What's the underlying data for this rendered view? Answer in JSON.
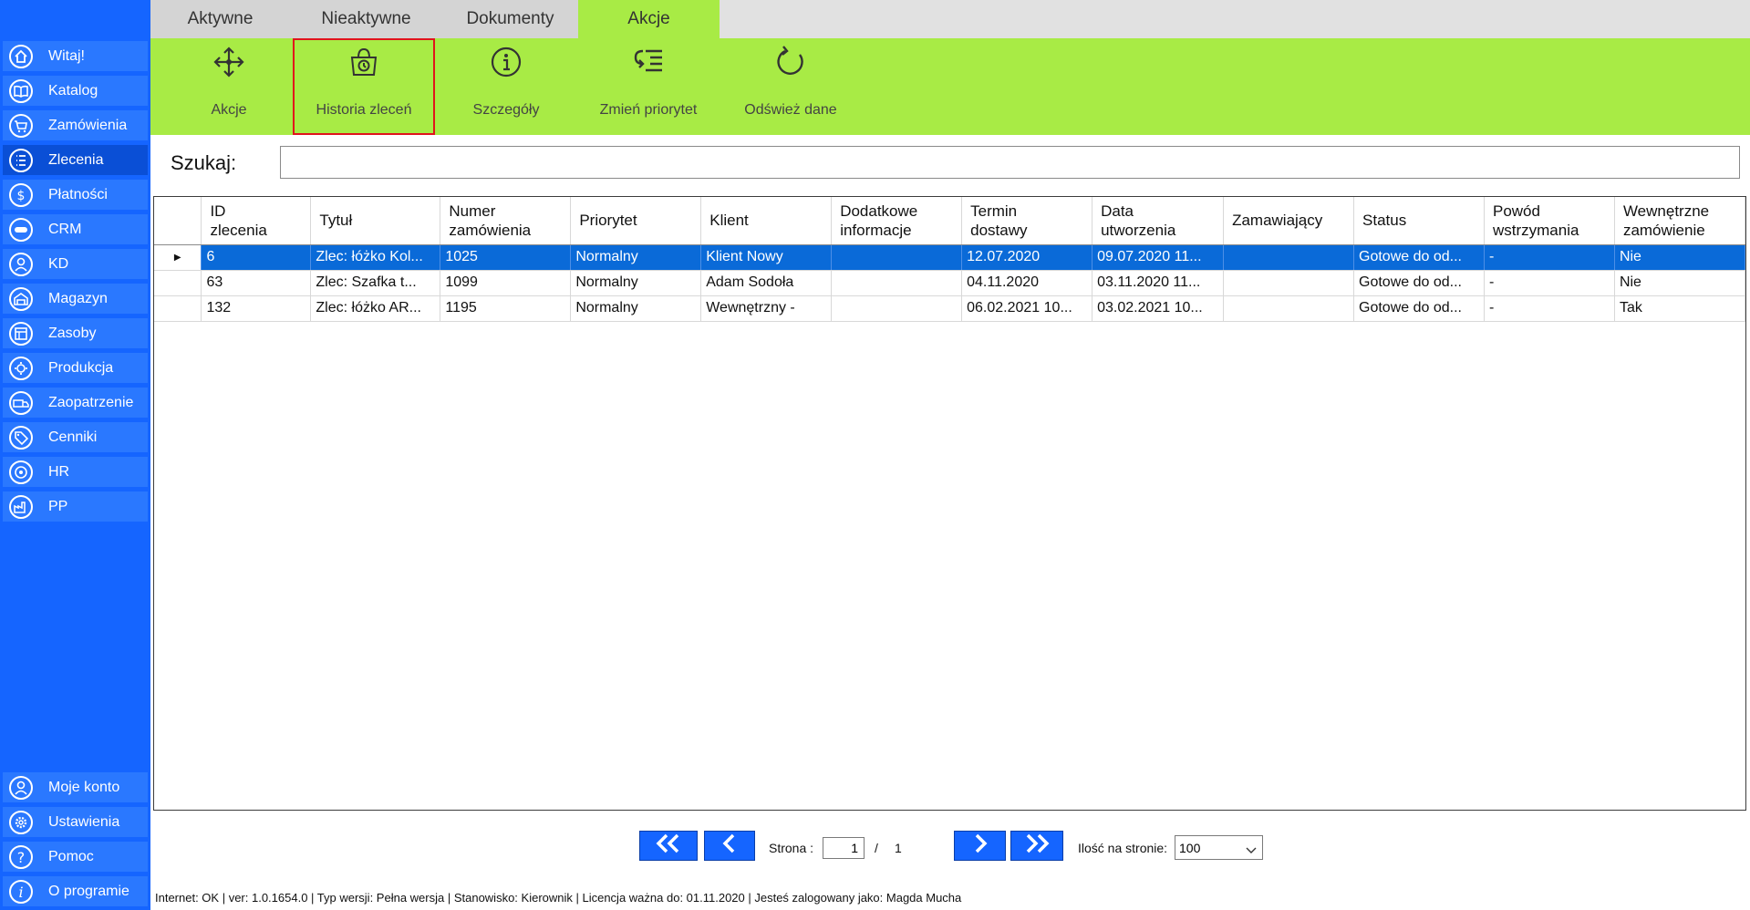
{
  "sidebar": {
    "items": [
      {
        "label": "Witaj!",
        "icon": "home-icon"
      },
      {
        "label": "Katalog",
        "icon": "book-icon"
      },
      {
        "label": "Zamówienia",
        "icon": "cart-icon"
      },
      {
        "label": "Zlecenia",
        "icon": "list-icon"
      },
      {
        "label": "Płatności",
        "icon": "dollar-icon"
      },
      {
        "label": "CRM",
        "icon": "crm-icon"
      },
      {
        "label": "KD",
        "icon": "person-icon"
      },
      {
        "label": "Magazyn",
        "icon": "warehouse-icon"
      },
      {
        "label": "Zasoby",
        "icon": "resources-icon"
      },
      {
        "label": "Produkcja",
        "icon": "production-icon"
      },
      {
        "label": "Zaopatrzenie",
        "icon": "truck-icon"
      },
      {
        "label": "Cenniki",
        "icon": "tag-icon"
      },
      {
        "label": "HR",
        "icon": "hr-icon"
      },
      {
        "label": "PP",
        "icon": "factory-icon"
      }
    ],
    "bottom": [
      {
        "label": "Moje konto",
        "icon": "user-icon"
      },
      {
        "label": "Ustawienia",
        "icon": "gear-icon"
      },
      {
        "label": "Pomoc",
        "icon": "help-icon"
      },
      {
        "label": "O programie",
        "icon": "info-icon"
      }
    ]
  },
  "tabs": [
    "Aktywne",
    "Nieaktywne",
    "Dokumenty",
    "Akcje"
  ],
  "ribbon": {
    "buttons": [
      {
        "label": "Akcje",
        "icon": "move-arrows-icon"
      },
      {
        "label": "Historia zleceń",
        "icon": "history-bag-icon"
      },
      {
        "label": "Szczegóły",
        "icon": "info-circle-icon"
      },
      {
        "label": "Zmień priorytet",
        "icon": "priority-list-icon"
      },
      {
        "label": "Odśwież dane",
        "icon": "refresh-icon"
      }
    ]
  },
  "search": {
    "label": "Szukaj:",
    "value": ""
  },
  "table": {
    "columns": [
      [
        "ID",
        "zlecenia"
      ],
      [
        "Tytuł",
        ""
      ],
      [
        "Numer",
        "zamówienia"
      ],
      [
        "Priorytet",
        ""
      ],
      [
        "Klient",
        ""
      ],
      [
        "Dodatkowe",
        "informacje"
      ],
      [
        "Termin",
        "dostawy"
      ],
      [
        "Data",
        "utworzenia"
      ],
      [
        "Zamawiający",
        ""
      ],
      [
        "Status",
        ""
      ],
      [
        "Powód",
        "wstrzymania"
      ],
      [
        "Wewnętrzne",
        "zamówienie"
      ]
    ],
    "rows": [
      [
        "6",
        "Zlec: łóżko Kol...",
        "1025",
        "Normalny",
        "Klient Nowy",
        "",
        "12.07.2020",
        "09.07.2020 11...",
        "",
        "Gotowe do od...",
        "-",
        "Nie"
      ],
      [
        "63",
        "Zlec: Szafka t...",
        "1099",
        "Normalny",
        "Adam Sodoła",
        "",
        "04.11.2020",
        "03.11.2020 11...",
        "",
        "Gotowe do od...",
        "-",
        "Nie"
      ],
      [
        "132",
        "Zlec: łóżko AR...",
        "1195",
        "Normalny",
        "Wewnętrzny -",
        "",
        "06.02.2021 10...",
        "03.02.2021 10...",
        "",
        "Gotowe do od...",
        "-",
        "Tak"
      ]
    ]
  },
  "pager": {
    "page_label": "Strona :",
    "page": "1",
    "separator": "/",
    "total": "1",
    "per_page_label": "Ilość na stronie:",
    "per_page": "100"
  },
  "status": {
    "text": "Internet: OK  |   ver: 1.0.1654.0   |   Typ wersji: Pełna wersja   |   Stanowisko: Kierownik   |   Licencja ważna do: 01.11.2020   |   Jesteś zalogowany jako: Magda Mucha"
  },
  "colors": {
    "sidebar": "#1565ff",
    "nav_item": "#2a78ff",
    "ribbon": "#a8eb45",
    "selected_row": "#0a6ad8",
    "highlight": "#e0141c"
  }
}
